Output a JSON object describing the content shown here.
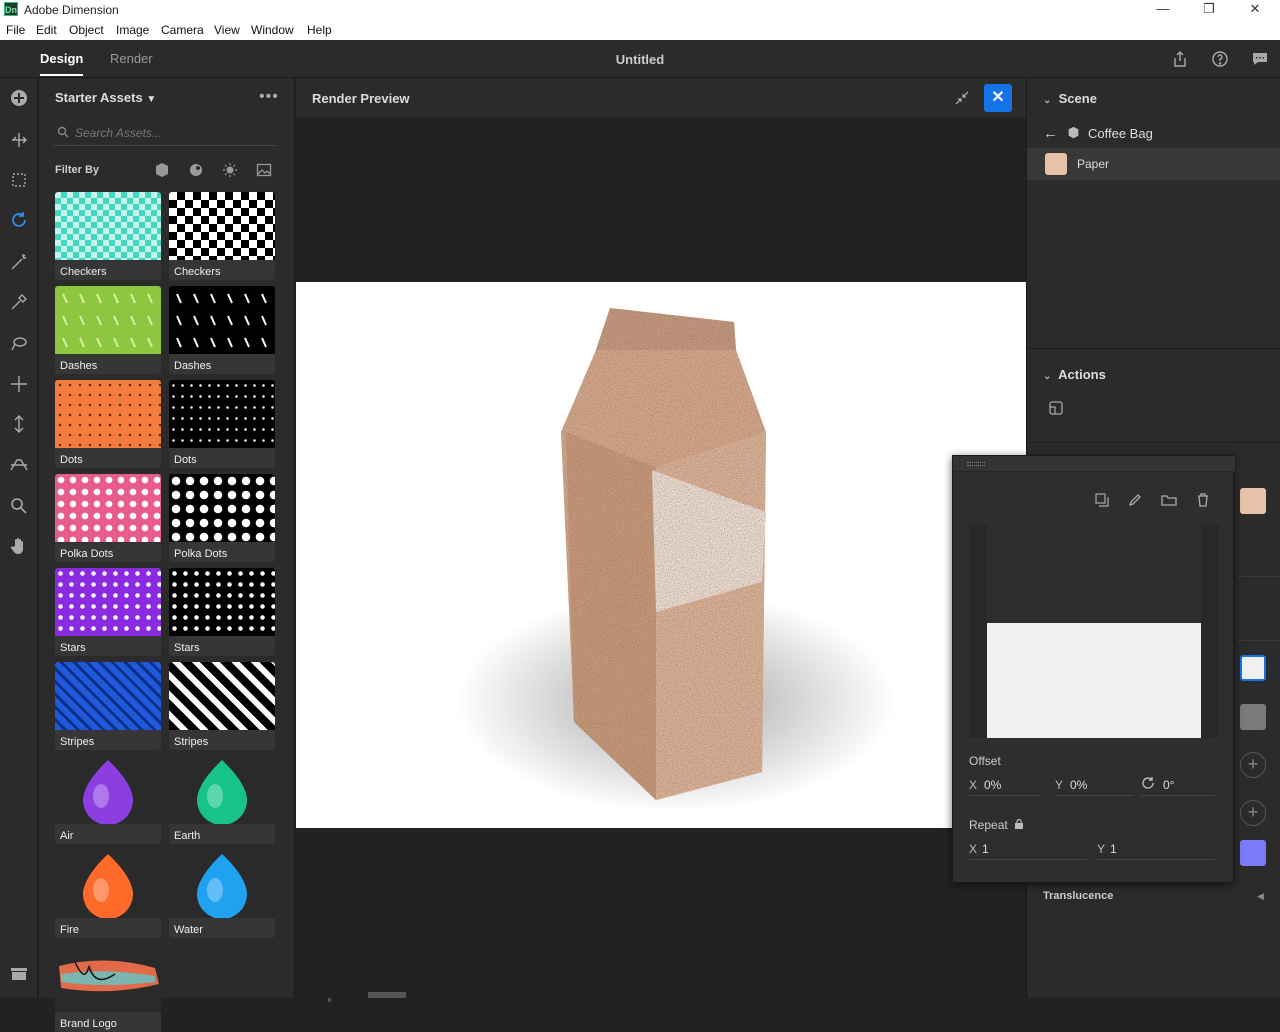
{
  "window": {
    "app_icon": "Dn",
    "title": "Adobe Dimension"
  },
  "menu": [
    "File",
    "Edit",
    "Object",
    "Image",
    "Camera",
    "View",
    "Window",
    "Help"
  ],
  "appbar": {
    "tabs": [
      "Design",
      "Render"
    ],
    "document_title": "Untitled"
  },
  "assets": {
    "header": "Starter Assets",
    "search_placeholder": "Search Assets...",
    "filter_label": "Filter By",
    "tiles": [
      {
        "label": "Checkers",
        "color": "#44d6c0"
      },
      {
        "label": "Checkers",
        "color": "#000000"
      },
      {
        "label": "Dashes",
        "color": "#8dc63f"
      },
      {
        "label": "Dashes",
        "color": "#000000"
      },
      {
        "label": "Dots",
        "color": "#f47c3c"
      },
      {
        "label": "Dots",
        "color": "#000000"
      },
      {
        "label": "Polka Dots",
        "color": "#e85c8a"
      },
      {
        "label": "Polka Dots",
        "color": "#000000"
      },
      {
        "label": "Stars",
        "color": "#8a2be2"
      },
      {
        "label": "Stars",
        "color": "#000000"
      },
      {
        "label": "Stripes",
        "color": "#1e5adb"
      },
      {
        "label": "Stripes",
        "color": "#000000"
      },
      {
        "label": "Air",
        "color": "#8b3fe0"
      },
      {
        "label": "Earth",
        "color": "#17c38a"
      },
      {
        "label": "Fire",
        "color": "#ff6a2a"
      },
      {
        "label": "Water",
        "color": "#1fa2f0"
      },
      {
        "label": "Brand Logo",
        "color": "#e06a4a"
      }
    ]
  },
  "render_preview": {
    "title": "Render Preview"
  },
  "scene": {
    "header": "Scene",
    "object": "Coffee Bag",
    "material": "Paper",
    "material_color": "#e8c2a8"
  },
  "actions": {
    "header": "Actions"
  },
  "image_popup": {
    "offset_label": "Offset",
    "offset_x": "0%",
    "offset_y": "0%",
    "rotation": "0°",
    "repeat_label": "Repeat",
    "repeat_x": "1",
    "repeat_y": "1",
    "x_axis": "X",
    "y_axis": "Y"
  },
  "properties": {
    "translucence_label": "Translucence"
  },
  "colors": {
    "accent": "#1473e6",
    "swatch_purple": "#7b7bf7",
    "swatch_gray": "#7a7a7a"
  }
}
